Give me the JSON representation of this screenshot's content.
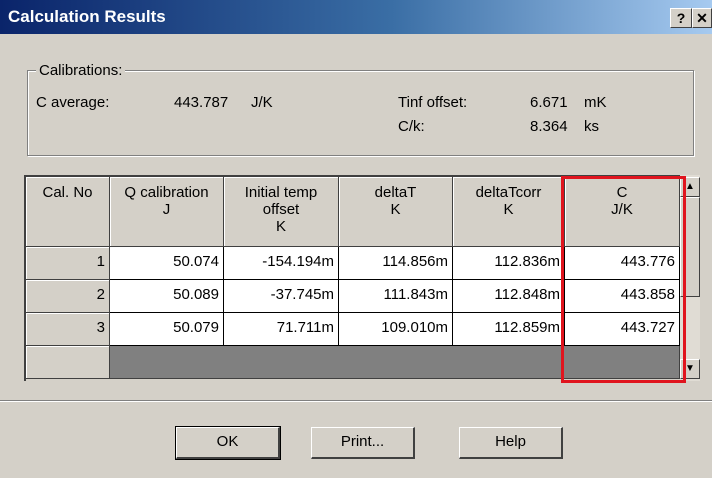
{
  "window": {
    "title": "Calculation Results",
    "help_glyph": "?",
    "close_glyph": "✕"
  },
  "calibrations": {
    "legend": "Calibrations:",
    "c_average_label": "C average:",
    "c_average_value": "443.787",
    "c_average_unit": "J/K",
    "tinf_label": "Tinf offset:",
    "tinf_value": "6.671",
    "tinf_unit": "mK",
    "ck_label": "C/k:",
    "ck_value": "8.364",
    "ck_unit": "ks"
  },
  "table": {
    "headers": [
      {
        "line1": "Cal. No",
        "line2": "",
        "line3": ""
      },
      {
        "line1": "Q calibration",
        "line2": "J",
        "line3": ""
      },
      {
        "line1": "Initial temp",
        "line2": "offset",
        "line3": "K"
      },
      {
        "line1": "deltaT",
        "line2": "K",
        "line3": ""
      },
      {
        "line1": "deltaTcorr",
        "line2": "K",
        "line3": ""
      },
      {
        "line1": "C",
        "line2": "J/K",
        "line3": ""
      }
    ],
    "rows": [
      {
        "no": "1",
        "q": "50.074",
        "init": "-154.194m",
        "dt": "114.856m",
        "dtc": "112.836m",
        "c": "443.776"
      },
      {
        "no": "2",
        "q": "50.089",
        "init": "-37.745m",
        "dt": "111.843m",
        "dtc": "112.848m",
        "c": "443.858"
      },
      {
        "no": "3",
        "q": "50.079",
        "init": "71.711m",
        "dt": "109.010m",
        "dtc": "112.859m",
        "c": "443.727"
      }
    ],
    "scroll_up": "▲",
    "scroll_down": "▼"
  },
  "buttons": {
    "ok": "OK",
    "print": "Print...",
    "help": "Help"
  },
  "colors": {
    "highlight": "#e0141e",
    "titlebar": "#0a246a"
  }
}
